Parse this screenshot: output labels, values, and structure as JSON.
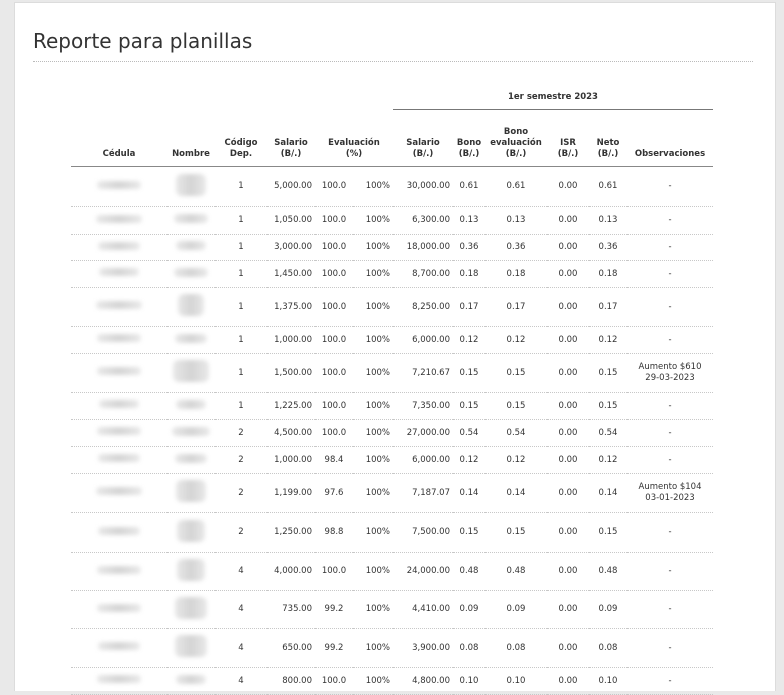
{
  "title": "Reporte para planillas",
  "group_header": "1er semestre 2023",
  "columns": {
    "cedula": "Cédula",
    "nombre": "Nombre",
    "codigo": [
      "Código",
      "Dep."
    ],
    "salario": [
      "Salario",
      "(B/.)"
    ],
    "evaluacion": [
      "Evaluación",
      "(%)"
    ],
    "salario_sem": [
      "Salario",
      "(B/.)"
    ],
    "bono": [
      "Bono",
      "(B/.)"
    ],
    "bono_eval": [
      "Bono",
      "evaluación",
      "(B/.)"
    ],
    "isr": [
      "ISR",
      "(B/.)"
    ],
    "neto": [
      "Neto",
      "(B/.)"
    ],
    "observaciones": "Observaciones"
  },
  "rows": [
    {
      "cod": "1",
      "sal": "5,000.00",
      "ev": "100.0",
      "pct": "100%",
      "sals": "30,000.00",
      "bono": "0.61",
      "beval": "0.61",
      "isr": "0.00",
      "neto": "0.61",
      "obs": [
        "-"
      ]
    },
    {
      "cod": "1",
      "sal": "1,050.00",
      "ev": "100.0",
      "pct": "100%",
      "sals": "6,300.00",
      "bono": "0.13",
      "beval": "0.13",
      "isr": "0.00",
      "neto": "0.13",
      "obs": [
        "-"
      ]
    },
    {
      "cod": "1",
      "sal": "3,000.00",
      "ev": "100.0",
      "pct": "100%",
      "sals": "18,000.00",
      "bono": "0.36",
      "beval": "0.36",
      "isr": "0.00",
      "neto": "0.36",
      "obs": [
        "-"
      ]
    },
    {
      "cod": "1",
      "sal": "1,450.00",
      "ev": "100.0",
      "pct": "100%",
      "sals": "8,700.00",
      "bono": "0.18",
      "beval": "0.18",
      "isr": "0.00",
      "neto": "0.18",
      "obs": [
        "-"
      ]
    },
    {
      "cod": "1",
      "sal": "1,375.00",
      "ev": "100.0",
      "pct": "100%",
      "sals": "8,250.00",
      "bono": "0.17",
      "beval": "0.17",
      "isr": "0.00",
      "neto": "0.17",
      "obs": [
        "-"
      ]
    },
    {
      "cod": "1",
      "sal": "1,000.00",
      "ev": "100.0",
      "pct": "100%",
      "sals": "6,000.00",
      "bono": "0.12",
      "beval": "0.12",
      "isr": "0.00",
      "neto": "0.12",
      "obs": [
        "-"
      ]
    },
    {
      "cod": "1",
      "sal": "1,500.00",
      "ev": "100.0",
      "pct": "100%",
      "sals": "7,210.67",
      "bono": "0.15",
      "beval": "0.15",
      "isr": "0.00",
      "neto": "0.15",
      "obs": [
        "Aumento $610",
        "29-03-2023"
      ]
    },
    {
      "cod": "1",
      "sal": "1,225.00",
      "ev": "100.0",
      "pct": "100%",
      "sals": "7,350.00",
      "bono": "0.15",
      "beval": "0.15",
      "isr": "0.00",
      "neto": "0.15",
      "obs": [
        "-"
      ]
    },
    {
      "cod": "2",
      "sal": "4,500.00",
      "ev": "100.0",
      "pct": "100%",
      "sals": "27,000.00",
      "bono": "0.54",
      "beval": "0.54",
      "isr": "0.00",
      "neto": "0.54",
      "obs": [
        "-"
      ]
    },
    {
      "cod": "2",
      "sal": "1,000.00",
      "ev": "98.4",
      "pct": "100%",
      "sals": "6,000.00",
      "bono": "0.12",
      "beval": "0.12",
      "isr": "0.00",
      "neto": "0.12",
      "obs": [
        "-"
      ]
    },
    {
      "cod": "2",
      "sal": "1,199.00",
      "ev": "97.6",
      "pct": "100%",
      "sals": "7,187.07",
      "bono": "0.14",
      "beval": "0.14",
      "isr": "0.00",
      "neto": "0.14",
      "obs": [
        "Aumento $104",
        "03-01-2023"
      ]
    },
    {
      "cod": "2",
      "sal": "1,250.00",
      "ev": "98.8",
      "pct": "100%",
      "sals": "7,500.00",
      "bono": "0.15",
      "beval": "0.15",
      "isr": "0.00",
      "neto": "0.15",
      "obs": [
        "-"
      ]
    },
    {
      "cod": "4",
      "sal": "4,000.00",
      "ev": "100.0",
      "pct": "100%",
      "sals": "24,000.00",
      "bono": "0.48",
      "beval": "0.48",
      "isr": "0.00",
      "neto": "0.48",
      "obs": [
        "-"
      ]
    },
    {
      "cod": "4",
      "sal": "735.00",
      "ev": "99.2",
      "pct": "100%",
      "sals": "4,410.00",
      "bono": "0.09",
      "beval": "0.09",
      "isr": "0.00",
      "neto": "0.09",
      "obs": [
        "-"
      ]
    },
    {
      "cod": "4",
      "sal": "650.00",
      "ev": "99.2",
      "pct": "100%",
      "sals": "3,900.00",
      "bono": "0.08",
      "beval": "0.08",
      "isr": "0.00",
      "neto": "0.08",
      "obs": [
        "-"
      ]
    },
    {
      "cod": "4",
      "sal": "800.00",
      "ev": "100.0",
      "pct": "100%",
      "sals": "4,800.00",
      "bono": "0.10",
      "beval": "0.10",
      "isr": "0.00",
      "neto": "0.10",
      "obs": [
        "-"
      ]
    }
  ]
}
